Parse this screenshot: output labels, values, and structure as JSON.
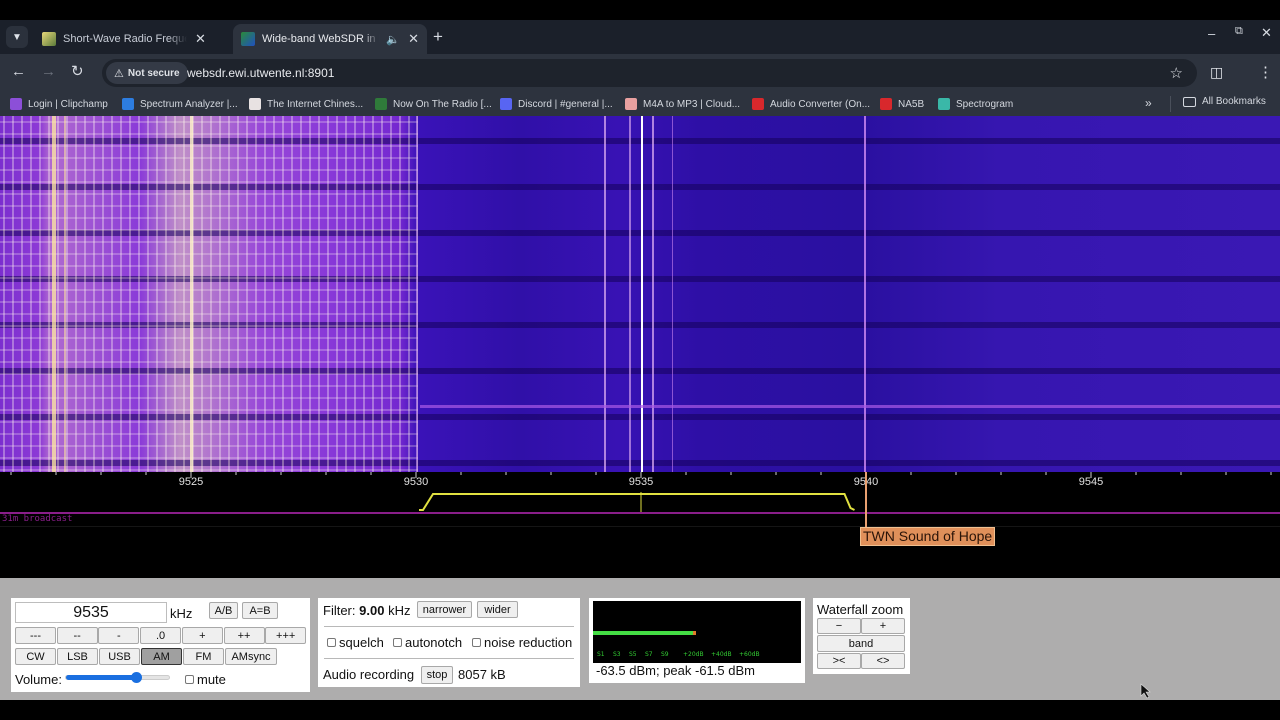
{
  "browser": {
    "tabs": [
      {
        "title": "Short-Wave Radio Frequency Sc",
        "active": false
      },
      {
        "title": "Wide-band WebSDR in Ensc",
        "active": true,
        "audio": true
      }
    ],
    "new_tab": "+",
    "security_label": "Not secure",
    "url": "websdr.ewi.utwente.nl:8901",
    "bookmarks": [
      {
        "label": "Login | Clipchamp",
        "color": "#8c4fd8"
      },
      {
        "label": "Spectrum Analyzer |...",
        "color": "#2d7de0"
      },
      {
        "label": "The Internet Chines...",
        "color": "#e8e2e2"
      },
      {
        "label": "Now On The Radio [...",
        "color": "#2f7a3a"
      },
      {
        "label": "Discord | #general |...",
        "color": "#5865f2"
      },
      {
        "label": "M4A to MP3 | Cloud...",
        "color": "#e8a0a0"
      },
      {
        "label": "Audio Converter (On...",
        "color": "#d8282c"
      },
      {
        "label": "NA5B",
        "color": "#d8282c"
      },
      {
        "label": "Spectrogram",
        "color": "#3ab8a8"
      }
    ],
    "more_bookmarks": "»",
    "all_bookmarks": "All Bookmarks"
  },
  "scale": {
    "ticks": [
      {
        "label": "9525",
        "khz": 9525
      },
      {
        "label": "9530",
        "khz": 9530
      },
      {
        "label": "9535",
        "khz": 9535
      },
      {
        "label": "9540",
        "khz": 9540
      },
      {
        "label": "9545",
        "khz": 9545
      }
    ],
    "band_label": "31m broadcast",
    "station_label": "TWN Sound of Hope",
    "station_khz": 9540,
    "passband_khz": [
      9530.2,
      9539.7
    ],
    "tuned_khz": 9535
  },
  "tuning": {
    "frequency": "9535",
    "unit": "kHz",
    "ab_label": "A/B",
    "aeqb_label": "A=B",
    "step_buttons": [
      "---",
      "--",
      "-",
      ".0",
      "+",
      "++",
      "+++"
    ],
    "modes": [
      "CW",
      "LSB",
      "USB",
      "AM",
      "FM",
      "AMsync"
    ],
    "active_mode": "AM",
    "volume_label": "Volume:",
    "volume_fraction": 0.68,
    "mute_label": "mute",
    "mute_checked": false
  },
  "filter": {
    "label": "Filter:",
    "value": "9.00",
    "unit": "kHz",
    "narrower_label": "narrower",
    "wider_label": "wider",
    "options": [
      {
        "label": "squelch",
        "checked": false
      },
      {
        "label": "autonotch",
        "checked": false
      },
      {
        "label": "noise reduction",
        "checked": false
      }
    ],
    "recording_label": "Audio recording",
    "stop_label": "stop",
    "recording_size": "8057 kB"
  },
  "smeter": {
    "labels": [
      "S1",
      "S3",
      "S5",
      "S7",
      "S9",
      "+20dB",
      "+40dB",
      "+60dB"
    ],
    "level_fraction": 0.49,
    "readout": "-63.5 dBm; peak  -61.5 dBm"
  },
  "waterfall_zoom": {
    "title": "Waterfall zoom",
    "minus_label": "−",
    "plus_label": "+",
    "band_label": "band",
    "narrow_label": "><",
    "wide_label": "<>"
  }
}
